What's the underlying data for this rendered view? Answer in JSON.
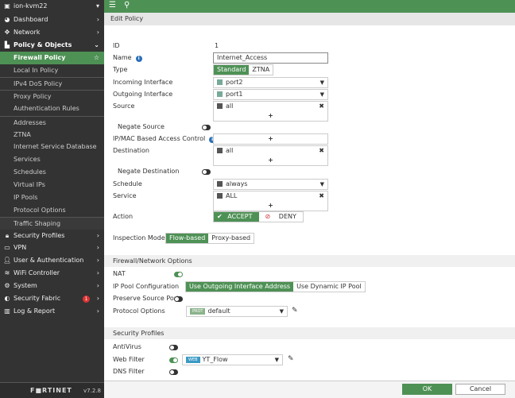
{
  "sidebar": {
    "device": "ion-kvm22",
    "items": [
      {
        "label": "Dashboard",
        "icon": "dashboard-icon"
      },
      {
        "label": "Network",
        "icon": "network-icon"
      },
      {
        "label": "Policy & Objects",
        "icon": "policy-icon"
      },
      {
        "label": "Firewall Policy"
      },
      {
        "label": "Local In Policy"
      },
      {
        "label": "IPv4 DoS Policy"
      },
      {
        "label": "Proxy Policy"
      },
      {
        "label": "Authentication Rules"
      },
      {
        "label": "Addresses"
      },
      {
        "label": "ZTNA"
      },
      {
        "label": "Internet Service Database"
      },
      {
        "label": "Services"
      },
      {
        "label": "Schedules"
      },
      {
        "label": "Virtual IPs"
      },
      {
        "label": "IP Pools"
      },
      {
        "label": "Protocol Options"
      },
      {
        "label": "Traffic Shaping"
      },
      {
        "label": "Security Profiles",
        "icon": "lock-icon"
      },
      {
        "label": "VPN",
        "icon": "laptop-icon"
      },
      {
        "label": "User & Authentication",
        "icon": "user-icon"
      },
      {
        "label": "WiFi Controller",
        "icon": "wifi-icon"
      },
      {
        "label": "System",
        "icon": "gear-icon"
      },
      {
        "label": "Security Fabric",
        "icon": "fabric-icon",
        "badge": "1"
      },
      {
        "label": "Log & Report",
        "icon": "chart-icon"
      }
    ],
    "brand": "F■RTINET",
    "version": "v7.2.8"
  },
  "header": {
    "title": "Edit Policy"
  },
  "form": {
    "id_label": "ID",
    "id_value": "1",
    "name_label": "Name",
    "name_value": "Internet_Access",
    "type_label": "Type",
    "type_options": [
      "Standard",
      "ZTNA"
    ],
    "incoming_label": "Incoming Interface",
    "incoming_value": "port2",
    "outgoing_label": "Outgoing Interface",
    "outgoing_value": "port1",
    "source_label": "Source",
    "source_value": "all",
    "negate_source_label": "Negate Source",
    "ipmac_label": "IP/MAC Based Access Control",
    "destination_label": "Destination",
    "destination_value": "all",
    "negate_destination_label": "Negate Destination",
    "schedule_label": "Schedule",
    "schedule_value": "always",
    "service_label": "Service",
    "service_value": "ALL",
    "action_label": "Action",
    "action_accept": "ACCEPT",
    "action_deny": "DENY",
    "inspection_label": "Inspection Mode",
    "inspection_options": [
      "Flow-based",
      "Proxy-based"
    ],
    "plus": "+"
  },
  "firewall_options": {
    "title": "Firewall/Network Options",
    "nat_label": "NAT",
    "ippool_label": "IP Pool Configuration",
    "ippool_options": [
      "Use Outgoing Interface Address",
      "Use Dynamic IP Pool"
    ],
    "preserve_label": "Preserve Source Port",
    "protocol_label": "Protocol Options",
    "protocol_tag": "PROT",
    "protocol_value": "default"
  },
  "security_profiles": {
    "title": "Security Profiles",
    "antivirus_label": "AntiVirus",
    "webfilter_label": "Web Filter",
    "webfilter_tag": "WEB",
    "webfilter_value": "YT_Flow",
    "dnsfilter_label": "DNS Filter"
  },
  "footer": {
    "ok": "OK",
    "cancel": "Cancel"
  },
  "colors": {
    "accent": "#4e9155",
    "sidebar": "#333333"
  }
}
